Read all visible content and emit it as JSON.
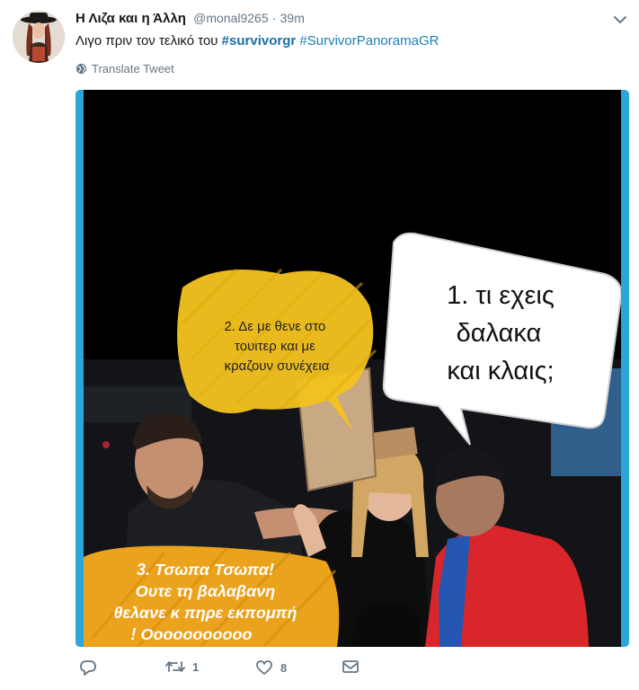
{
  "tweet": {
    "display_name": "Η Λιζα και η Άλλη",
    "handle": "@monal9265",
    "separator": "·",
    "time": "39m",
    "text_prefix": "Λιγο πριν τον τελικό του",
    "hashtag_1": "#survivorgr",
    "hashtag_2": "#SurvivorPanoramaGR",
    "translate_label": "Translate Tweet"
  },
  "media": {
    "bubble_1": [
      "1. τι εχεις",
      "δαλακα",
      "και κλαις;"
    ],
    "bubble_2": [
      "2. Δε με θενε στο",
      "τουιτερ και με",
      "κραζουν συνέχεια"
    ],
    "bubble_3": [
      "3. Τσωπα Τσωπα!",
      "Ουτε τη βαλαβανη",
      "θελανε κ πηρε εκπομπή",
      "! Οοοοοοοοοοο"
    ]
  },
  "actions": {
    "reply_count": "",
    "retweet_count": "1",
    "like_count": "8"
  },
  "colors": {
    "link": "#1b7fb8",
    "muted": "#657786",
    "media_border": "#2ba6d9",
    "yellow_bubble": "#f2c21f"
  }
}
